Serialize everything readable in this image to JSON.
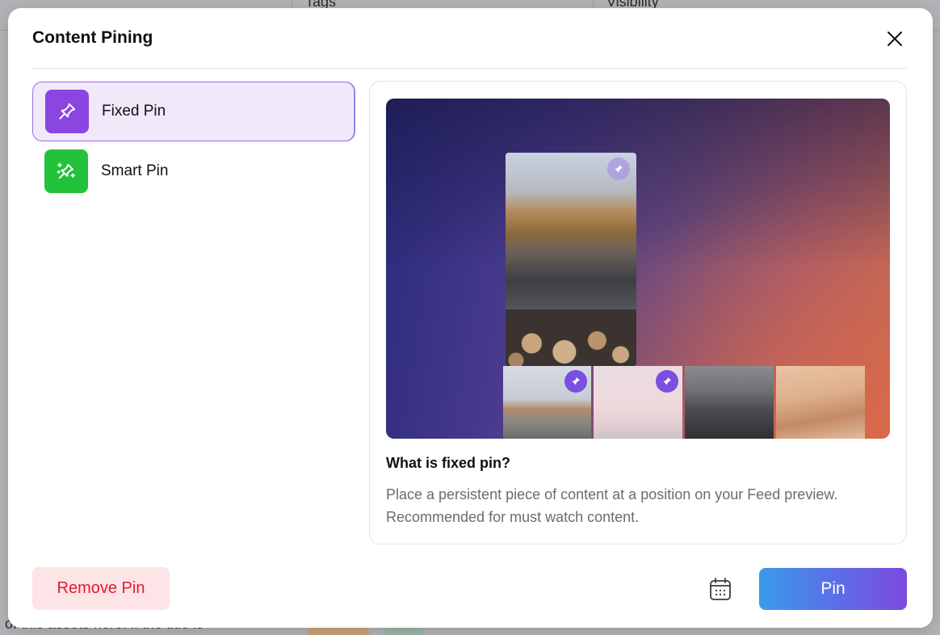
{
  "background": {
    "columns": [
      "Tags",
      "Visibility"
    ],
    "bottom_text": "of this assets here. if the title is"
  },
  "modal": {
    "title": "Content Pining",
    "close_icon": "close-icon",
    "options": [
      {
        "label": "Fixed Pin",
        "icon": "pin-icon",
        "color": "#8b45e0",
        "selected": true
      },
      {
        "label": "Smart Pin",
        "icon": "sparkle-pin-icon",
        "color": "#22c23a",
        "selected": false
      }
    ],
    "preview": {
      "heading": "What is fixed pin?",
      "description": "Place a persistent piece of content at a position on your Feed preview. Recommended for must watch content."
    },
    "footer": {
      "remove_label": "Remove Pin",
      "calendar_icon": "calendar-icon",
      "pin_label": "Pin"
    }
  },
  "colors": {
    "accent": "#7b4ae0",
    "danger": "#e11d2e",
    "smart_green": "#22c23a"
  }
}
